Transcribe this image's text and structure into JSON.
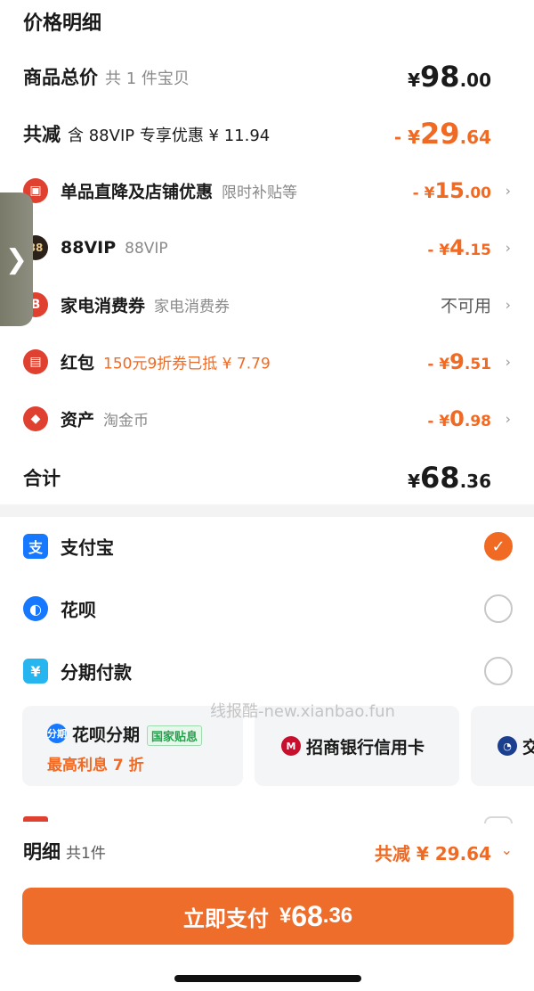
{
  "price_detail": {
    "heading": "价格明细",
    "goods_total": {
      "label": "商品总价",
      "note": "共 1 件宝贝",
      "currency": "¥",
      "int": "98",
      "dec": ".00"
    },
    "total_reduce": {
      "label": "共减",
      "note": "含 88VIP 专享优惠 ¥ 11.94",
      "prefix": "- ¥",
      "int": "29",
      "dec": ".64"
    },
    "items": [
      {
        "name": "单品直降及店铺优惠",
        "note": "限时补贴等",
        "prefix": "- ¥",
        "int": "15",
        "dec": ".00",
        "icon": "shop-icon",
        "icon_color": "#e0402f"
      },
      {
        "name": "88VIP",
        "note": "88VIP",
        "prefix": "- ¥",
        "int": "4",
        "dec": ".15",
        "icon": "88vip-icon",
        "icon_color": "#2b2118"
      },
      {
        "name": "家电消费券",
        "note": "家电消费券",
        "status": "不可用",
        "icon": "coupon-icon",
        "icon_color": "#e0402f"
      },
      {
        "name": "红包",
        "note": "150元9折券已抵 ¥ 7.79",
        "prefix": "- ¥",
        "int": "9",
        "dec": ".51",
        "icon": "red-packet-icon",
        "icon_color": "#e0402f"
      },
      {
        "name": "资产",
        "note": "淘金币",
        "prefix": "- ¥",
        "int": "0",
        "dec": ".98",
        "icon": "tag-icon",
        "icon_color": "#e0402f"
      }
    ],
    "subtotal": {
      "label": "合计",
      "currency": "¥",
      "int": "68",
      "dec": ".36"
    }
  },
  "payment_methods": [
    {
      "label": "支付宝",
      "icon": "alipay-icon",
      "icon_color": "#1677ff",
      "checked": true
    },
    {
      "label": "花呗",
      "icon": "huabei-icon",
      "icon_color": "#1677ff",
      "checked": false
    },
    {
      "label": "分期付款",
      "icon": "installment-icon",
      "icon_color": "#27b5f0",
      "checked": false
    }
  ],
  "cards": [
    {
      "title": "花呗分期",
      "tag": "国家贴息",
      "sub": "最高利息 7 折",
      "icon": "huabei-installment-icon",
      "icon_text": "分期"
    },
    {
      "title": "招商银行信用卡",
      "icon": "cmb-icon"
    },
    {
      "title": "交",
      "icon": "bocom-icon"
    }
  ],
  "watermark": "线报酷-new.xianbao.fun",
  "footer": {
    "detail_label": "明细",
    "detail_count": "共1件",
    "detail_total": "共减 ¥ 29.64",
    "pay_button": {
      "label": "立即支付",
      "currency": "¥",
      "int": "68",
      "dec": ".36"
    }
  },
  "side_tab_glyph": "❯"
}
